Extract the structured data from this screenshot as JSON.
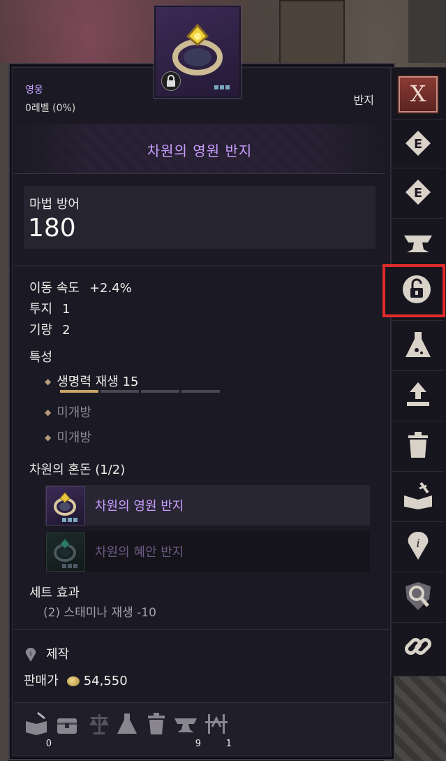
{
  "tooltip": {
    "grade": "영웅",
    "level": "0레벨 (0%)",
    "type": "반지",
    "item_name": "차원의 영원 반지",
    "main_stat": {
      "label": "마법 방어",
      "value": "180"
    },
    "stats": [
      {
        "label": "이동 속도",
        "value": "+2.4%"
      },
      {
        "label": "투지",
        "value": "1"
      },
      {
        "label": "기량",
        "value": "2"
      }
    ],
    "traits_title": "특성",
    "traits": [
      {
        "label": "생명력 재생",
        "value": "15",
        "active": true,
        "progress": 0.25
      },
      {
        "label": "미개방",
        "active": false
      },
      {
        "label": "미개방",
        "active": false
      }
    ],
    "set": {
      "title": "차원의 혼돈 (1/2)",
      "items": [
        {
          "name": "차원의 영원 반지",
          "owned": true
        },
        {
          "name": "차원의 혜안 반지",
          "owned": false
        }
      ],
      "effect_title": "세트 효과",
      "effect": "(2) 스태미나 재생 -10"
    },
    "craft_label": "제작",
    "price_label": "판매가",
    "price_value": "54,550",
    "bottom_icons": [
      {
        "icon": "book-quill-icon",
        "count": "0"
      },
      {
        "icon": "chest-icon",
        "count": ""
      },
      {
        "icon": "scales-icon",
        "count": ""
      },
      {
        "icon": "flask-icon",
        "count": ""
      },
      {
        "icon": "trash-icon",
        "count": ""
      },
      {
        "icon": "anvil-icon",
        "count": "9"
      },
      {
        "icon": "crossed-swords-icon",
        "count": "1"
      }
    ]
  },
  "sidebar": {
    "close_label": "X",
    "buttons": [
      "equip-e-icon",
      "equip-e2-icon",
      "anvil-icon",
      "unlock-icon",
      "flask-icon",
      "upload-icon",
      "trash-icon",
      "book-sword-icon",
      "info-icon",
      "magnifier-icon",
      "link-icon"
    ],
    "selected": "unlock-icon",
    "accent": "#e12a2a"
  }
}
